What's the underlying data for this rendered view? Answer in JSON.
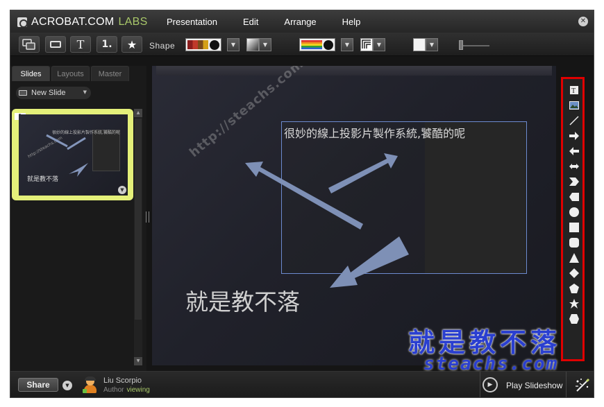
{
  "app": {
    "brand": "ACROBAT.COM",
    "brand_suffix": "LABS"
  },
  "menu": [
    "Presentation",
    "Edit",
    "Arrange",
    "Help"
  ],
  "toolbar": {
    "shape_label": "Shape",
    "text_icon_label": "T",
    "number_icon_label": "1."
  },
  "left_panel": {
    "tabs": [
      "Slides",
      "Layouts",
      "Master"
    ],
    "active_tab": "Slides",
    "new_slide_label": "New Slide",
    "thumbnail": {
      "number": "1",
      "title": "很妙的線上投影片製作系統,饕酷的呢",
      "subtitle": "就是教不落",
      "watermark": "http://steachs.com"
    }
  },
  "slide": {
    "title": "很妙的線上投影片製作系統,饕酷的呢",
    "subtitle": "就是教不落",
    "watermark": "http://steachs.com"
  },
  "shape_tools": [
    "text-tool-icon",
    "image-tool-icon",
    "line-tool-icon",
    "arrow-right-icon",
    "arrow-left-icon",
    "double-arrow-icon",
    "chevron-icon",
    "notched-chevron-icon",
    "circle-icon",
    "square-icon",
    "rounded-square-icon",
    "triangle-icon",
    "diamond-icon",
    "pentagon-icon",
    "star-icon",
    "hexagon-icon"
  ],
  "bottom": {
    "share_label": "Share",
    "user_name": "Liu Scorpio",
    "user_role": "Author",
    "user_status": "viewing",
    "play_label": "Play Slideshow"
  },
  "overlay": {
    "watermark_cn": "就是教不落",
    "watermark_url": "steachs.com"
  },
  "colors": {
    "accent_green": "#a9c86a",
    "selection_blue": "#6d8bd0",
    "highlight_red": "#e00000",
    "thumb_highlight": "#e4f07a"
  }
}
